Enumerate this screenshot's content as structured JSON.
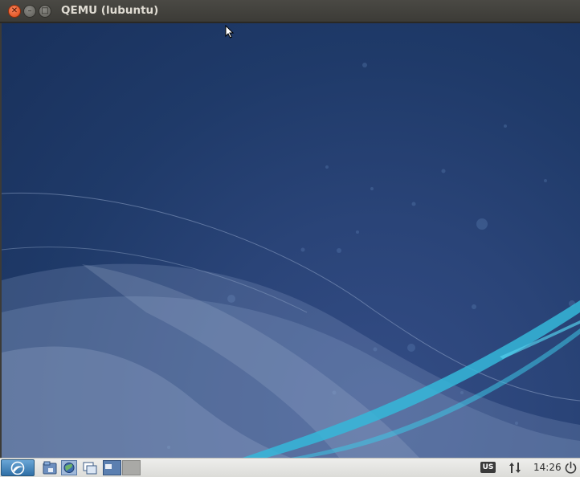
{
  "window": {
    "title": "QEMU (lubuntu)",
    "controls": {
      "close_icon": "close-icon",
      "minimize_icon": "minimize-icon",
      "maximize_icon": "maximize-icon"
    }
  },
  "desktop": {
    "wallpaper": "lubuntu-blue-waves",
    "colors": {
      "background": "#1f3a69",
      "wave_light": "#7e93b8",
      "wave_cyan": "#35b7d9"
    }
  },
  "taskbar": {
    "start_icon": "lubuntu-menu-icon",
    "launchers": [
      {
        "icon": "file-manager-icon"
      },
      {
        "icon": "browser-icon"
      },
      {
        "icon": "show-desktop-icon"
      }
    ],
    "pager": {
      "desktops": [
        {
          "name": "desktop-1",
          "active": true
        },
        {
          "name": "desktop-2",
          "active": false
        }
      ]
    },
    "tray": {
      "keyboard_layout": "US",
      "network_icon": "network-arrows-icon",
      "clock": "14:26",
      "power_icon": "power-icon"
    }
  }
}
